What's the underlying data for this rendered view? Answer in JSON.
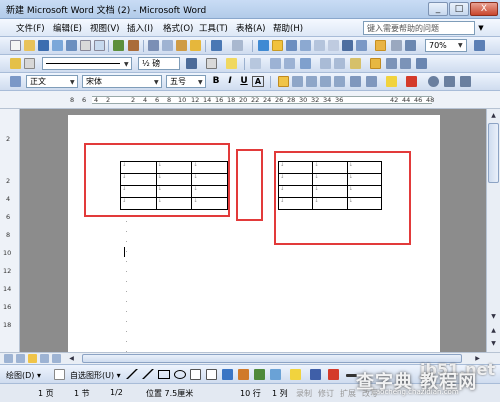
{
  "window": {
    "title": "新建 Microsoft Word 文档 (2) - Microsoft Word",
    "minimize": "_",
    "maximize": "□",
    "close": "X"
  },
  "menubar": {
    "items": [
      "文件(F)",
      "编辑(E)",
      "视图(V)",
      "插入(I)",
      "格式(O)",
      "工具(T)",
      "表格(A)",
      "帮助(H)"
    ],
    "help_placeholder": "键入需要帮助的问题"
  },
  "standard_toolbar": {
    "zoom": "70%"
  },
  "drawing_table_toolbar": {
    "line_weight": "½ 磅"
  },
  "format_toolbar": {
    "style": "正文",
    "font": "宋体",
    "size": "五号",
    "bold": "B",
    "italic": "I",
    "underline": "U",
    "char_border": "A"
  },
  "ruler": {
    "labels": [
      "8",
      "6",
      "4",
      "2",
      "",
      "2",
      "4",
      "6",
      "8",
      "10",
      "12",
      "14",
      "16",
      "18",
      "20",
      "22",
      "24",
      "26",
      "28",
      "30",
      "32",
      "34",
      "36",
      "",
      "42",
      "44",
      "46",
      "48"
    ]
  },
  "vruler": {
    "labels": [
      "2",
      "",
      "2",
      "4",
      "6",
      "8",
      "10",
      "12",
      "14",
      "16",
      "18"
    ]
  },
  "document": {
    "table_left": {
      "rows": 4,
      "cols": 3
    },
    "table_right": {
      "rows": 4,
      "cols": 3
    },
    "cell_mark": "↓"
  },
  "drawbar": {
    "draw_label": "绘图(D) ▾",
    "autoshapes_label": "自选图形(U) ▾"
  },
  "statusbar": {
    "page": "1 页",
    "section": "1 节",
    "pages": "1/2",
    "position": "位置 7.5厘米",
    "line": "10 行",
    "column": "1 列",
    "rec": "录制",
    "trk": "修订",
    "ext": "扩展",
    "ovr": "改写"
  },
  "watermark": {
    "site": "jb51.net",
    "name": "查字典 教程网",
    "url": "jiaocheng.chazidian.com"
  }
}
